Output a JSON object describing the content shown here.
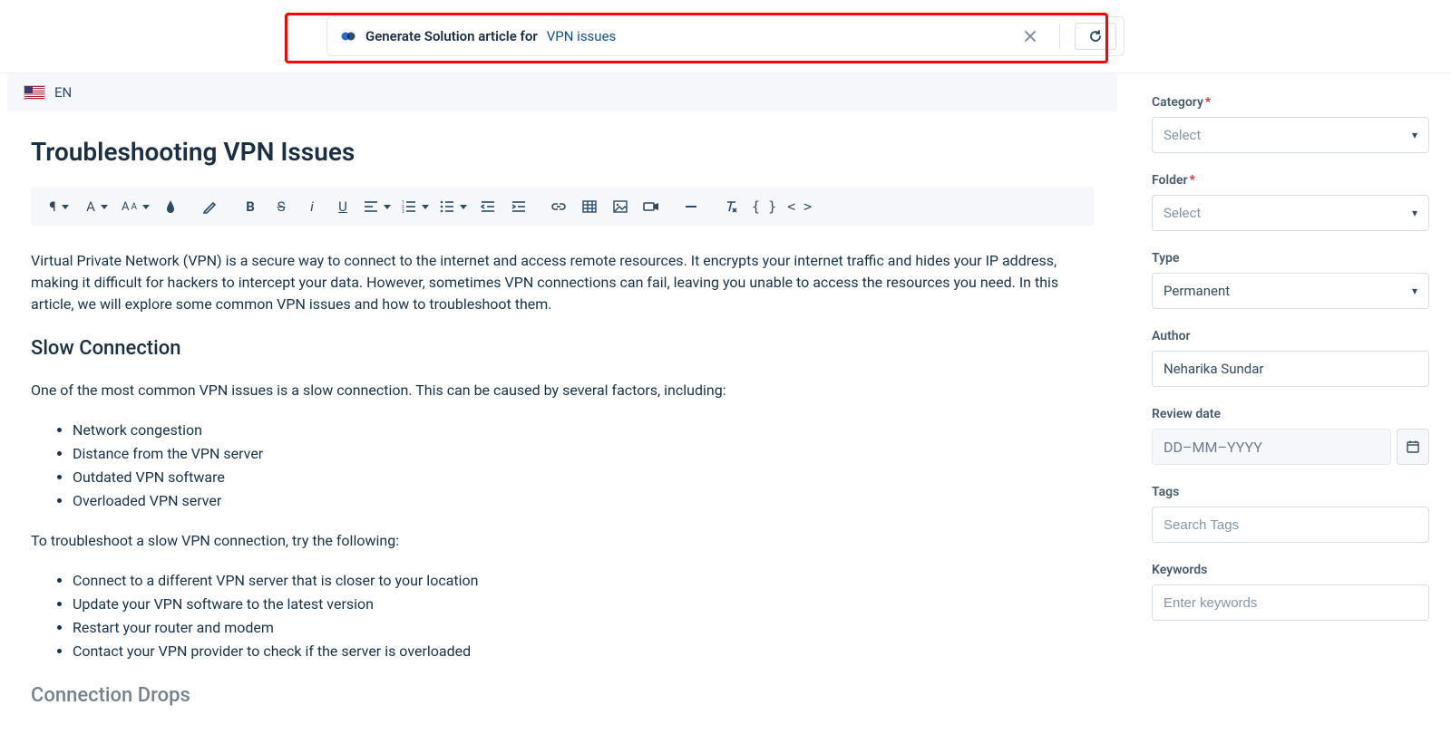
{
  "aiBar": {
    "label": "Generate Solution article for",
    "topic": "VPN issues"
  },
  "language": {
    "code": "EN"
  },
  "article": {
    "title": "Troubleshooting VPN Issues",
    "intro": "Virtual Private Network (VPN) is a secure way to connect to the internet and access remote resources. It encrypts your internet traffic and hides your IP address, making it difficult for hackers to intercept your data. However, sometimes VPN connections can fail, leaving you unable to access the resources you need. In this article, we will explore some common VPN issues and how to troubleshoot them.",
    "section1_heading": "Slow Connection",
    "section1_intro": "One of the most common VPN issues is a slow connection. This can be caused by several factors, including:",
    "section1_causes": [
      "Network congestion",
      "Distance from the VPN server",
      "Outdated VPN software",
      "Overloaded VPN server"
    ],
    "section1_troubleshoot_intro": "To troubleshoot a slow VPN connection, try the following:",
    "section1_fixes": [
      "Connect to a different VPN server that is closer to your location",
      "Update your VPN software to the latest version",
      "Restart your router and modem",
      "Contact your VPN provider to check if the server is overloaded"
    ],
    "section2_heading": "Connection Drops"
  },
  "sidebar": {
    "category": {
      "label": "Category",
      "required": true,
      "value": "Select"
    },
    "folder": {
      "label": "Folder",
      "required": true,
      "value": "Select"
    },
    "type": {
      "label": "Type",
      "value": "Permanent"
    },
    "author": {
      "label": "Author",
      "value": "Neharika Sundar"
    },
    "reviewDate": {
      "label": "Review date",
      "placeholder": "DD–MM–YYYY"
    },
    "tags": {
      "label": "Tags",
      "placeholder": "Search Tags"
    },
    "keywords": {
      "label": "Keywords",
      "placeholder": "Enter keywords"
    }
  }
}
